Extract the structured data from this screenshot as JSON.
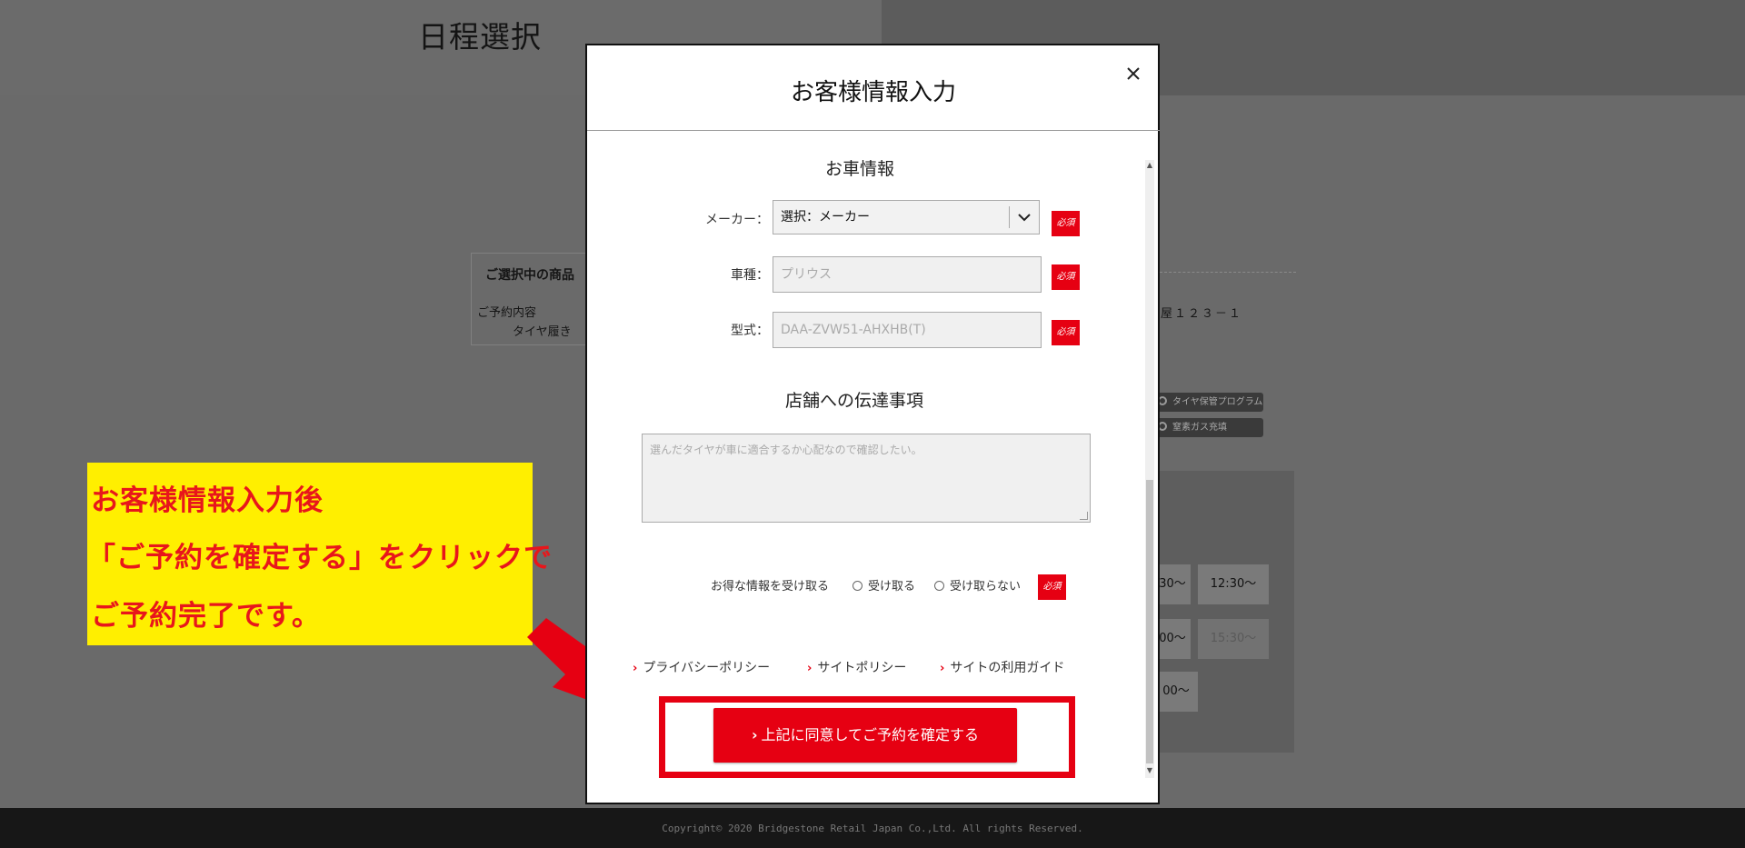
{
  "page": {
    "title": "日程選択",
    "copyright": "Copyright© 2020 Bridgestone Retail Japan Co.,Ltd. All rights Reserved."
  },
  "background": {
    "summary_head": "ご選択中の商品",
    "summary_label": "ご予約内容",
    "summary_item": "タイヤ履き",
    "address_fragment": "屋１２３－１",
    "badges": [
      "タイヤ保管プログラム",
      "窒素ガス充填"
    ],
    "time_slots": [
      "30〜",
      "12:30〜",
      "00〜",
      "15:30〜",
      "00〜"
    ]
  },
  "annotation": {
    "lines": [
      "お客様情報入力後",
      "「ご予約を確定する」をクリックで",
      "ご予約完了です。"
    ],
    "color": "#e8161b",
    "background": "#ffef00"
  },
  "modal": {
    "title": "お客様情報入力",
    "close_icon": "close-icon",
    "car_section": {
      "title": "お車情報",
      "maker_label": "メーカー：",
      "maker_value": "選択：メーカー",
      "model_label": "車種：",
      "model_placeholder": "プリウス",
      "type_label": "型式：",
      "type_placeholder": "DAA-ZVW51-AHXHB(T)",
      "required_badge": "必須"
    },
    "message_section": {
      "title": "店舗への伝達事項",
      "placeholder": "選んだタイヤが車に適合するか心配なので確認したい。"
    },
    "newsletter": {
      "label": "お得な情報を受け取る",
      "options": [
        "受け取る",
        "受け取らない"
      ],
      "required_badge": "必須"
    },
    "links": [
      "プライバシーポリシー",
      "サイトポリシー",
      "サイトの利用ガイド"
    ],
    "confirm_button": "上記に同意してご予約を確定する",
    "accent_color": "#e60012"
  }
}
